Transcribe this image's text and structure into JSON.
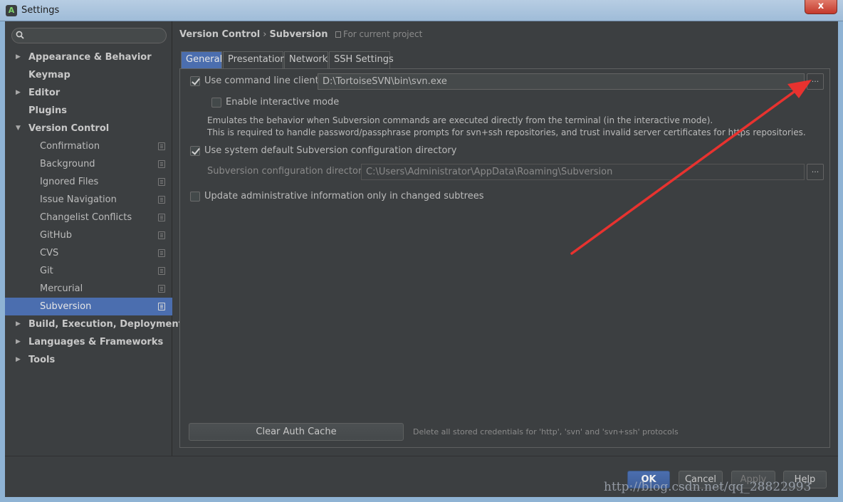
{
  "window": {
    "title": "Settings",
    "close_glyph": "x"
  },
  "search": {
    "placeholder": ""
  },
  "tree": {
    "items": [
      {
        "label": "Appearance & Behavior",
        "level": "top",
        "expander": "collapsed"
      },
      {
        "label": "Keymap",
        "level": "top"
      },
      {
        "label": "Editor",
        "level": "top",
        "expander": "collapsed"
      },
      {
        "label": "Plugins",
        "level": "top"
      },
      {
        "label": "Version Control",
        "level": "top",
        "expander": "expanded"
      },
      {
        "label": "Confirmation",
        "level": "child"
      },
      {
        "label": "Background",
        "level": "child"
      },
      {
        "label": "Ignored Files",
        "level": "child"
      },
      {
        "label": "Issue Navigation",
        "level": "child"
      },
      {
        "label": "Changelist Conflicts",
        "level": "child"
      },
      {
        "label": "GitHub",
        "level": "child"
      },
      {
        "label": "CVS",
        "level": "child"
      },
      {
        "label": "Git",
        "level": "child"
      },
      {
        "label": "Mercurial",
        "level": "child"
      },
      {
        "label": "Subversion",
        "level": "child",
        "selected": true
      },
      {
        "label": "Build, Execution, Deployment",
        "level": "top",
        "expander": "collapsed"
      },
      {
        "label": "Languages & Frameworks",
        "level": "top",
        "expander": "collapsed"
      },
      {
        "label": "Tools",
        "level": "top",
        "expander": "collapsed"
      }
    ]
  },
  "breadcrumb": {
    "parent": "Version Control",
    "separator": "›",
    "current": "Subversion",
    "scope": "For current project"
  },
  "tabs": [
    "General",
    "Presentation",
    "Network",
    "SSH Settings"
  ],
  "general": {
    "use_cmd_client_label": "Use command line client:",
    "use_cmd_client_checked": true,
    "cmd_client_path": "D:\\TortoiseSVN\\bin\\svn.exe",
    "browse_label": "...",
    "interactive_label": "Enable interactive mode",
    "interactive_checked": false,
    "interactive_desc_1": "Emulates the behavior when Subversion commands are executed directly from the terminal (in the interactive mode).",
    "interactive_desc_2": "This is required to handle password/passphrase prompts for svn+ssh repositories, and trust invalid server certificates for https repositories.",
    "use_default_config_label": "Use system default Subversion configuration directory",
    "use_default_config_checked": true,
    "config_dir_label": "Subversion configuration directory:",
    "config_dir_value": "C:\\Users\\Administrator\\AppData\\Roaming\\Subversion",
    "update_admin_label": "Update administrative information only in changed subtrees",
    "update_admin_checked": false,
    "clear_cache_label": "Clear Auth Cache",
    "clear_cache_desc": "Delete all stored credentials for 'http', 'svn' and 'svn+ssh' protocols"
  },
  "buttons": {
    "ok": "OK",
    "cancel": "Cancel",
    "apply": "Apply",
    "help": "Help"
  },
  "watermark": "http://blog.csdn.net/qq_28822993",
  "colors": {
    "background": "#3c3f41",
    "selection": "#4b6eaf",
    "annotation_arrow": "#e8322f"
  }
}
